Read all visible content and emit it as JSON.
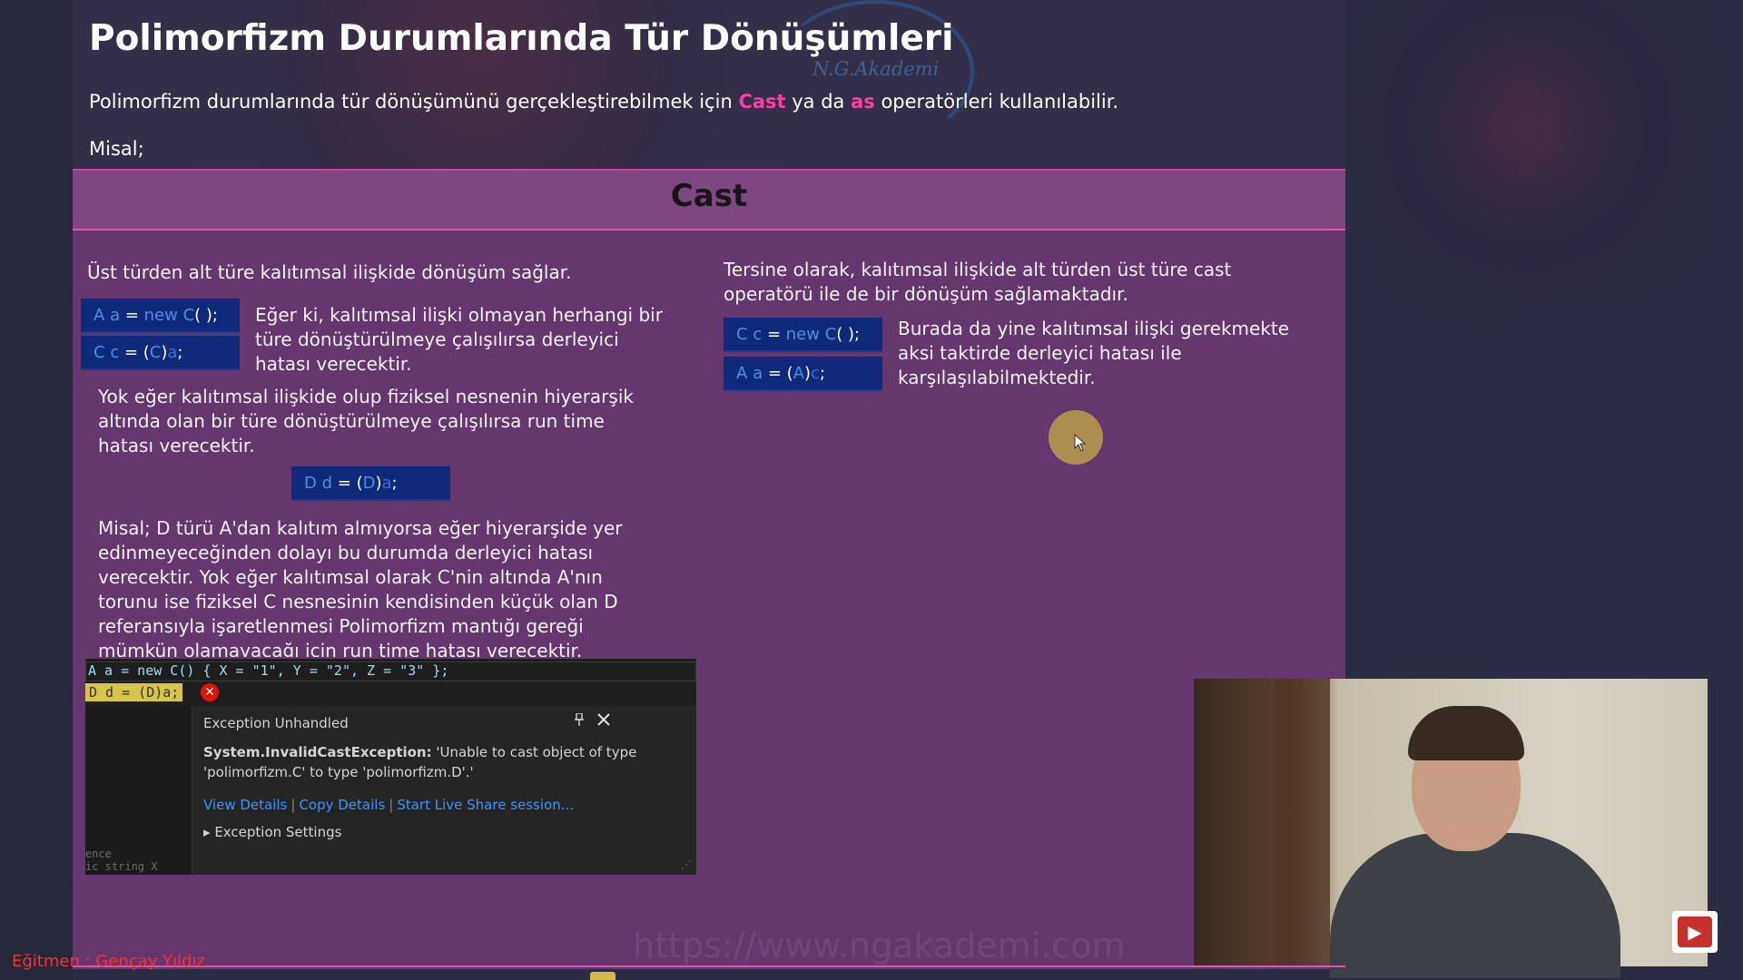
{
  "slide": {
    "title": "Polimorfizm Durumlarında Tür Dönüşümleri",
    "logo_text": "N.G.Akademi",
    "intro_before": "Polimorfizm durumlarında tür dönüşümünü gerçekleştirebilmek için ",
    "intro_cast": "Cast",
    "intro_mid": " ya da ",
    "intro_as": "as",
    "intro_after": " operatörleri kullanılabilir.",
    "misal": "Misal;",
    "section_title": "Cast",
    "left": {
      "p1": "Üst türden alt türe kalıtımsal ilişkide dönüşüm sağlar.",
      "code1_a": "A",
      "code1_b": "a",
      "code1_eq": " = ",
      "code1_new": "new",
      "code1_cls": " C",
      "code1_tail": "( );",
      "code2_a": "C",
      "code2_b": "c",
      "code2_eq": " = (",
      "code2_cls": "C",
      "code2_close": ")",
      "code2_var": "a",
      "code2_semi": ";",
      "p2": "Eğer ki, kalıtımsal ilişki olmayan herhangi bir türe dönüştürülmeye çalışılırsa derleyici hatası verecektir.",
      "p3": "Yok eğer kalıtımsal ilişkide olup fiziksel nesnenin hiyerarşik altında olan bir türe dönüştürülmeye çalışılırsa run time hatası verecektir.",
      "code3_a": "D",
      "code3_b": "d",
      "code3_eq": " = (",
      "code3_cls": "D",
      "code3_close": ")",
      "code3_var": "a",
      "code3_semi": ";",
      "p4": "Misal; D türü A'dan kalıtım almıyorsa eğer hiyerarşide yer edinmeyeceğinden dolayı bu durumda derleyici hatası verecektir. Yok eğer kalıtımsal olarak C'nin altında A'nın torunu ise fiziksel C nesnesinin kendisinden küçük olan D referansıyla işaretlenmesi Polimorfizm mantığı gereği mümkün olamayacağı için run time hatası verecektir."
    },
    "right": {
      "p1": "Tersine olarak, kalıtımsal ilişkide alt türden üst türe cast operatörü ile de bir dönüşüm sağlamaktadır.",
      "code1_a": "C",
      "code1_b": "c",
      "code1_eq": " = ",
      "code1_new": "new",
      "code1_cls": " C",
      "code1_tail": "( );",
      "code2_a": "A",
      "code2_b": "a",
      "code2_eq": " = (",
      "code2_cls": "A",
      "code2_close": ")",
      "code2_var": "c",
      "code2_semi": ";",
      "p2": "Burada da yine kalıtımsal ilişki gerekmekte aksi taktirde derleyici hatası ile karşılaşılabilmektedir."
    }
  },
  "ide": {
    "line1": "A a = new C() { X = \"1\", Y = \"2\", Z = \"3\" };",
    "line2": "D d = (D)a;",
    "error_icon": "✕",
    "bottom_text_1": "ence",
    "bottom_text_2": "ic string X",
    "popup": {
      "title": "Exception Unhandled",
      "pin_icon": "pin-icon",
      "close_icon": "close-icon",
      "exception_type": "System.InvalidCastException:",
      "exception_message": " 'Unable to cast object of type 'polimorfizm.C' to type 'polimorfizm.D'.'",
      "links": [
        "View Details",
        "Copy Details",
        "Start Live Share session..."
      ],
      "settings": "Exception Settings"
    }
  },
  "footer": {
    "instructor": "Eğitmen : Gençay Yıldız",
    "watermark": "https://www.ngakademi.com"
  },
  "colors": {
    "highlight": "#ff3ea5",
    "content_bg": "#66376e",
    "code_bg": "#0f2a7a",
    "credit": "#ff2e2e"
  }
}
